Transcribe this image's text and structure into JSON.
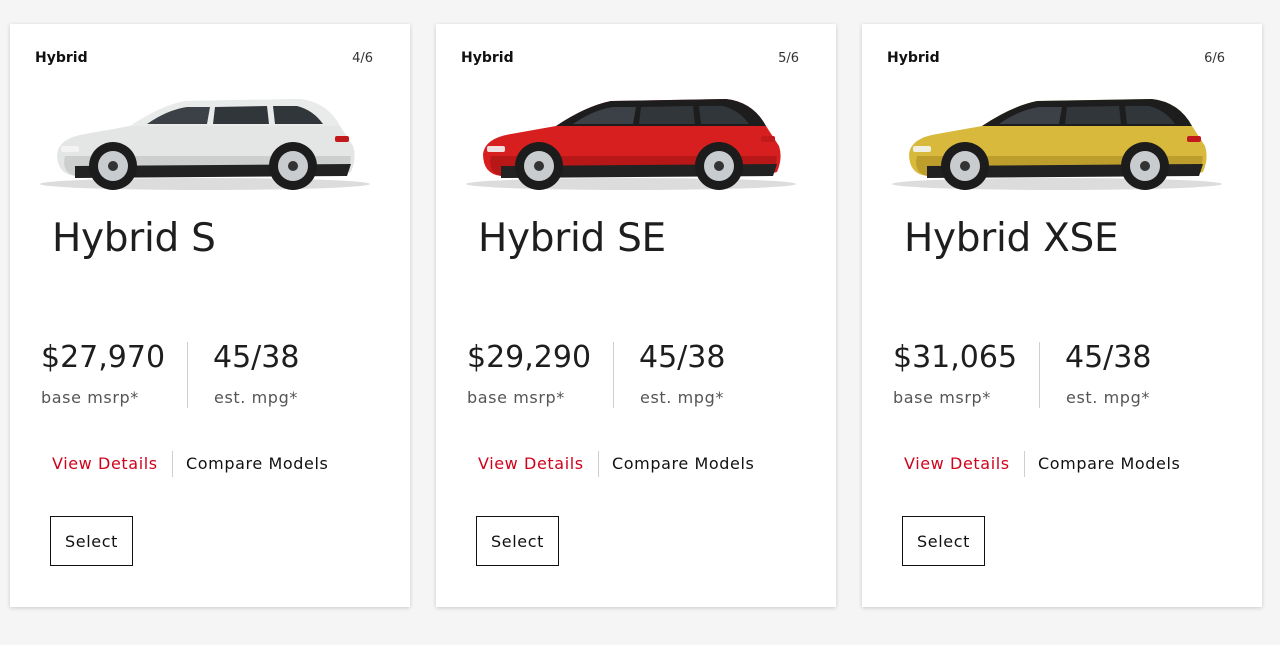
{
  "cards": [
    {
      "badge": "Hybrid",
      "counter": "4/6",
      "name": "Hybrid S",
      "price": "$27,970",
      "price_label": "base msrp*",
      "mpg": "45/38",
      "mpg_label": "est. mpg*",
      "view_details": "View Details",
      "compare": "Compare Models",
      "select": "Select",
      "car_color": "#e4e6e6",
      "car_shade": "#b9bcbc",
      "roof_color": "#e9ebeb"
    },
    {
      "badge": "Hybrid",
      "counter": "5/6",
      "name": "Hybrid SE",
      "price": "$29,290",
      "price_label": "base msrp*",
      "mpg": "45/38",
      "mpg_label": "est. mpg*",
      "view_details": "View Details",
      "compare": "Compare Models",
      "select": "Select",
      "car_color": "#d81f1f",
      "car_shade": "#9e1010",
      "roof_color": "#1d1d1d"
    },
    {
      "badge": "Hybrid",
      "counter": "6/6",
      "name": "Hybrid XSE",
      "price": "$31,065",
      "price_label": "base msrp*",
      "mpg": "45/38",
      "mpg_label": "est. mpg*",
      "view_details": "View Details",
      "compare": "Compare Models",
      "select": "Select",
      "car_color": "#d8b93c",
      "car_shade": "#a8861f",
      "roof_color": "#1d1d1d"
    }
  ],
  "colors": {
    "accent": "#d0021b",
    "background": "#f5f5f5",
    "card": "#ffffff"
  }
}
